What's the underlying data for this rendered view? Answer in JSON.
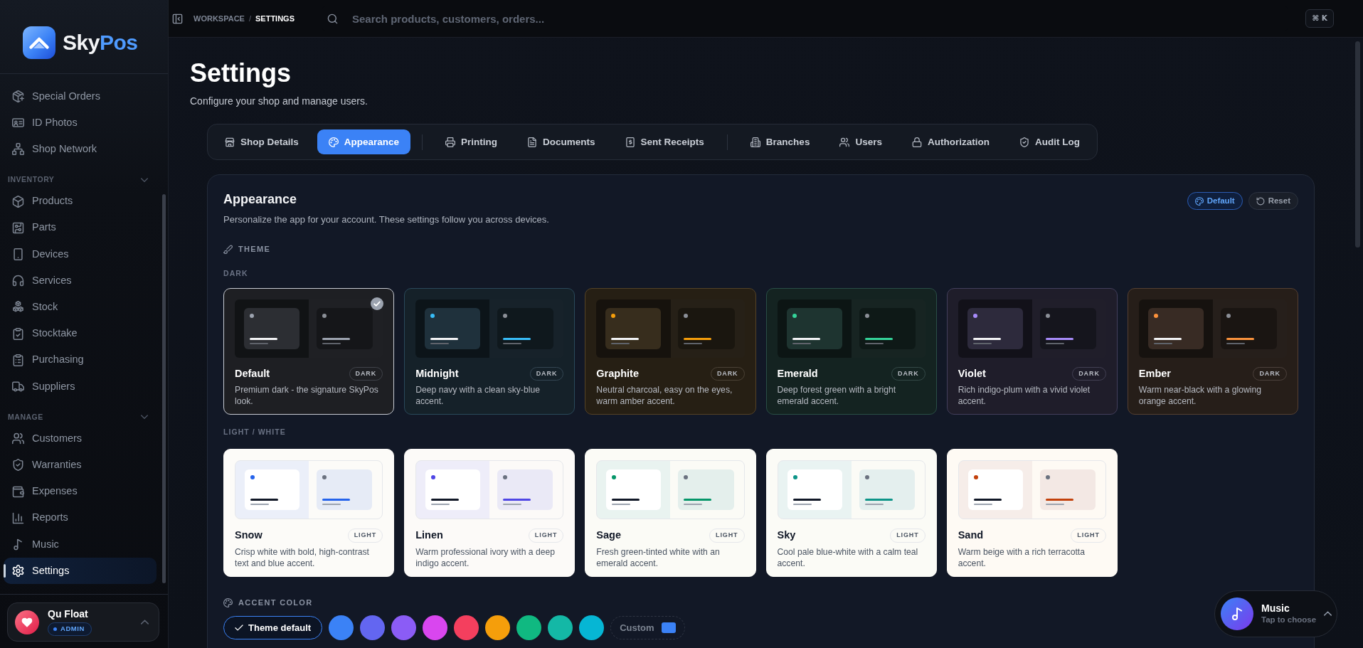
{
  "brand": {
    "name": "Sky",
    "name_highlight": "Pos"
  },
  "sidebar": {
    "sections": [
      {
        "items": [
          {
            "label": "Special Orders",
            "selected": false
          },
          {
            "label": "ID Photos",
            "selected": false
          },
          {
            "label": "Shop Network",
            "selected": false
          }
        ]
      },
      {
        "title": "INVENTORY",
        "expanded": true,
        "items": [
          {
            "label": "Products",
            "selected": false
          },
          {
            "label": "Parts",
            "selected": false
          },
          {
            "label": "Devices",
            "selected": false
          },
          {
            "label": "Services",
            "selected": false
          },
          {
            "label": "Stock",
            "selected": false
          },
          {
            "label": "Stocktake",
            "selected": false
          },
          {
            "label": "Purchasing",
            "selected": false
          },
          {
            "label": "Suppliers",
            "selected": false
          }
        ]
      },
      {
        "title": "MANAGE",
        "expanded": true,
        "items": [
          {
            "label": "Customers",
            "selected": false
          },
          {
            "label": "Warranties",
            "selected": false
          },
          {
            "label": "Expenses",
            "selected": false
          },
          {
            "label": "Reports",
            "selected": false
          },
          {
            "label": "Music",
            "selected": false
          },
          {
            "label": "Settings",
            "selected": true
          }
        ]
      }
    ]
  },
  "user": {
    "name": "Qu Float",
    "role": "ADMIN"
  },
  "topbar": {
    "breadcrumb": {
      "items": [
        "WORKSPACE",
        "SETTINGS"
      ],
      "separator": "/"
    },
    "search": {
      "placeholder": "Search products, customers, orders..."
    },
    "shortcut": "⌘ K"
  },
  "page": {
    "title": "Settings",
    "subtitle": "Configure your shop and manage users."
  },
  "tab_groups": [
    {
      "tabs": [
        {
          "label": "Shop Details",
          "selected": false
        },
        {
          "label": "Appearance",
          "selected": true
        }
      ]
    },
    {
      "tabs": [
        {
          "label": "Printing",
          "selected": false
        },
        {
          "label": "Documents",
          "selected": false
        },
        {
          "label": "Sent Receipts",
          "selected": false
        }
      ]
    },
    {
      "tabs": [
        {
          "label": "Branches",
          "selected": false
        },
        {
          "label": "Users",
          "selected": false
        },
        {
          "label": "Authorization",
          "selected": false
        },
        {
          "label": "Audit Log",
          "selected": false
        }
      ]
    }
  ],
  "appearance": {
    "title": "Appearance",
    "description": "Personalize the app for your account. These settings follow you across devices.",
    "actions": [
      {
        "label": "Default",
        "kind": "preset"
      },
      {
        "label": "Reset",
        "kind": "reset"
      }
    ]
  },
  "theme": {
    "title": "THEME",
    "groups": [
      {
        "title": "DARK",
        "kind": "dark",
        "themes": [
          {
            "name": "Default",
            "badge": "DARK",
            "description": "Premium dark - the signature SkyPos look.",
            "color": "#9ca3af",
            "selected": true
          },
          {
            "name": "Midnight",
            "badge": "DARK",
            "description": "Deep navy with a clean sky-blue accent.",
            "color": "#38bdf8",
            "selected": false
          },
          {
            "name": "Graphite",
            "badge": "DARK",
            "description": "Neutral charcoal, easy on the eyes, warm amber accent.",
            "color": "#f59e0b",
            "selected": false
          },
          {
            "name": "Emerald",
            "badge": "DARK",
            "description": "Deep forest green with a bright emerald accent.",
            "color": "#34d399",
            "selected": false
          },
          {
            "name": "Violet",
            "badge": "DARK",
            "description": "Rich indigo-plum with a vivid violet accent.",
            "color": "#a78bfa",
            "selected": false
          },
          {
            "name": "Ember",
            "badge": "DARK",
            "description": "Warm near-black with a glowing orange accent.",
            "color": "#fb923c",
            "selected": false
          }
        ]
      },
      {
        "title": "LIGHT / WHITE",
        "kind": "light",
        "themes": [
          {
            "name": "Snow",
            "badge": "LIGHT",
            "description": "Crisp white with bold, high-contrast text and blue accent.",
            "color": "#2563eb",
            "selected": false
          },
          {
            "name": "Linen",
            "badge": "LIGHT",
            "description": "Warm professional ivory with a deep indigo accent.",
            "color": "#4f46e5",
            "selected": false
          },
          {
            "name": "Sage",
            "badge": "LIGHT",
            "description": "Fresh green-tinted white with an emerald accent.",
            "color": "#059669",
            "selected": false
          },
          {
            "name": "Sky",
            "badge": "LIGHT",
            "description": "Cool pale blue-white with a calm teal accent.",
            "color": "#0d9488",
            "selected": false
          },
          {
            "name": "Sand",
            "badge": "LIGHT",
            "description": "Warm beige with a rich terracotta accent.",
            "color": "#c2410c",
            "selected": false
          }
        ]
      }
    ]
  },
  "accent": {
    "title": "ACCENT COLOR",
    "default_option": {
      "label": "Theme default",
      "selected": true
    },
    "swatches": [
      {
        "color": "#3b82f6",
        "selected": false
      },
      {
        "color": "#6366f1",
        "selected": false
      },
      {
        "color": "#8b5cf6",
        "selected": false
      },
      {
        "color": "#d946ef",
        "selected": false
      },
      {
        "color": "#f43f5e",
        "selected": false
      },
      {
        "color": "#f59e0b",
        "selected": false
      },
      {
        "color": "#10b981",
        "selected": false
      },
      {
        "color": "#14b8a6",
        "selected": false
      },
      {
        "color": "#06b6d4",
        "selected": false
      }
    ],
    "custom": {
      "label": "Custom",
      "color": "#3b82f6",
      "selected": false
    }
  },
  "music": {
    "title": "Music",
    "subtitle": "Tap to choose"
  }
}
